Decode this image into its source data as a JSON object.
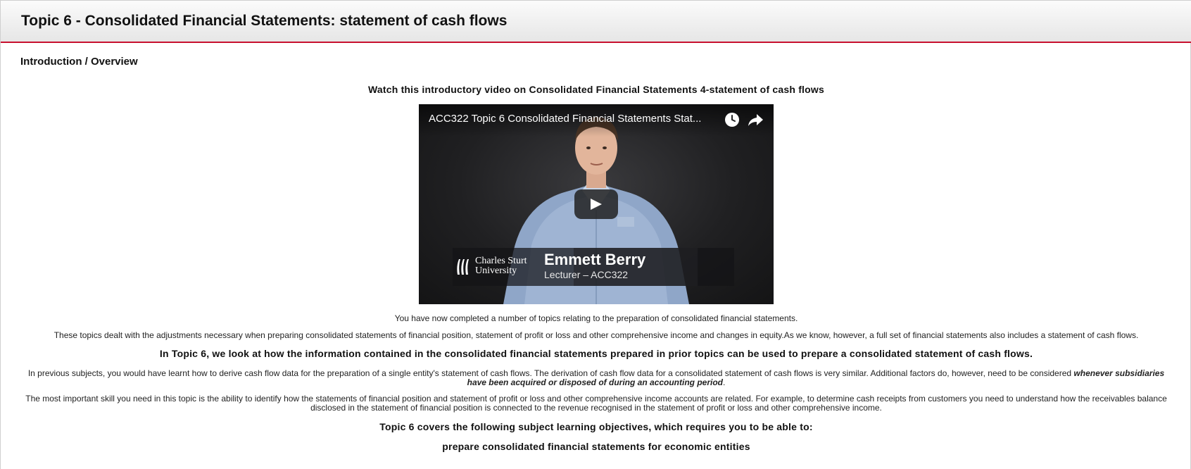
{
  "header": {
    "title": "Topic 6 - Consolidated Financial Statements: statement of cash flows"
  },
  "section": {
    "heading": "Introduction / Overview"
  },
  "intro_line": "Watch this introductory video on Consolidated Financial Statements 4-statement of cash flows",
  "video": {
    "title": "ACC322 Topic 6 Consolidated Financial Statements Stat...",
    "logo_line1": "Charles Sturt",
    "logo_line2": "University",
    "speaker_name": "Emmett Berry",
    "speaker_role": "Lecturer – ACC322",
    "icons": [
      "clock-icon",
      "share-icon",
      "play-icon"
    ]
  },
  "content": {
    "p1": "You have now completed a number of topics relating to the preparation of consolidated financial statements.",
    "p2": "These topics dealt with the adjustments necessary when preparing consolidated statements of financial position, statement of profit or loss and other comprehensive income and changes in equity.As we know, however, a full set of financial statements also includes a statement of cash flows.",
    "p3": "In Topic 6, we look at how the information contained in the consolidated financial statements prepared in prior topics can be used to prepare a consolidated statement of cash flows.",
    "p4_text": "In previous subjects, you would have learnt how to derive cash flow data for the preparation of a single entity's statement of cash flows. The derivation of cash flow data for a consolidated statement of cash flows is very similar. Additional factors do, however, need to be considered ",
    "p4_emphasis": "whenever subsidiaries have been acquired or disposed of during an accounting period",
    "p4_end": ".",
    "p5": "The most important skill you need in this topic is the ability to identify how the statements of financial position and statement of profit or loss and other comprehensive income accounts are related. For example, to determine cash receipts from customers you need to understand how the receivables balance disclosed in the statement of financial position is connected to the revenue recognised in the statement of profit or loss and other comprehensive income.",
    "p6": "Topic 6 covers the following subject learning objectives, which requires you to be able to:",
    "p7": "prepare consolidated financial statements for economic entities"
  },
  "colors": {
    "accent": "#c8102e",
    "header_bg": "#ececec",
    "video_bg": "#1d1d1f"
  }
}
